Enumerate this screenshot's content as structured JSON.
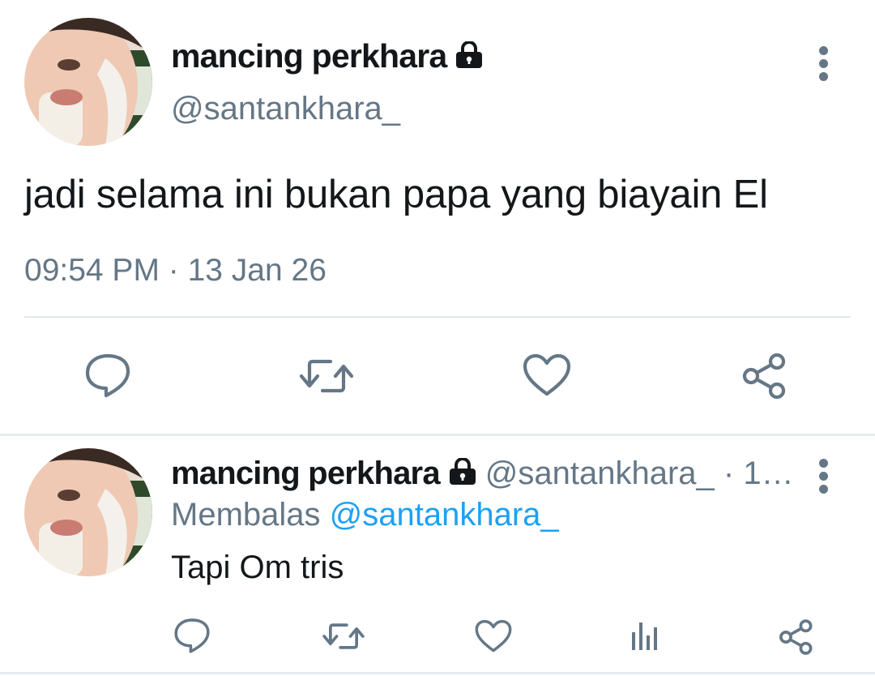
{
  "main_tweet": {
    "display_name": "mancing perkhara",
    "handle": "@santankhara_",
    "text": "jadi selama ini bukan papa yang biayain El",
    "timestamp": "09:54 PM · 13 Jan 26"
  },
  "reply_tweet": {
    "display_name": "mancing perkhara",
    "handle_time": "@santankhara_ · 1…",
    "replying_label": "Membalas",
    "replying_to": "@santankhara_",
    "text": "Tapi Om tris"
  },
  "icons": {
    "lock": "lock-icon",
    "more": "more-vertical-icon",
    "reply": "reply-icon",
    "retweet": "retweet-icon",
    "like": "heart-icon",
    "analytics": "analytics-icon",
    "share": "share-icon"
  },
  "colors": {
    "text": "#14171a",
    "secondary": "#657786",
    "link": "#1da1f2",
    "divider": "#e1e8ed"
  }
}
